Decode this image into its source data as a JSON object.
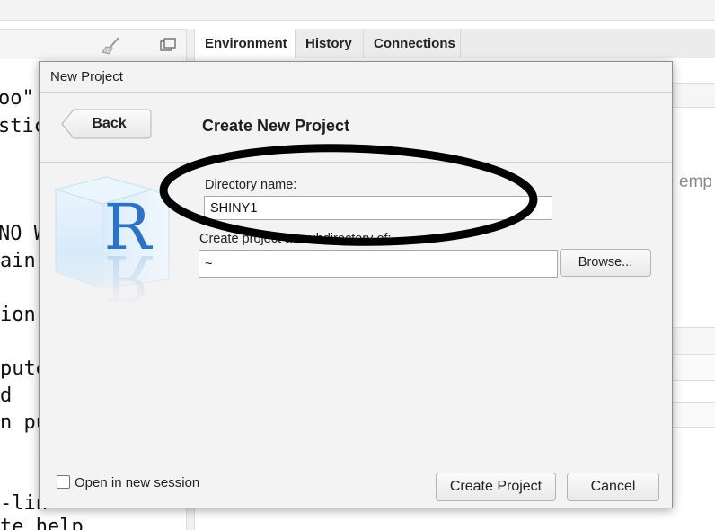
{
  "ide": {
    "tabs": [
      "Environment",
      "History",
      "Connections"
    ],
    "console_lines": [
      "oo\"",
      "stic",
      "NO W",
      "ain",
      "ion",
      "pute",
      "d",
      "n pu",
      "-lin",
      "te help"
    ],
    "environment_empty_text": "emp"
  },
  "dialog": {
    "title": "New Project",
    "back_label": "Back",
    "heading": "Create New Project",
    "directory_name": {
      "label": "Directory name:",
      "value": "SHINY1"
    },
    "subdirectory": {
      "label": "Create project as subdirectory of:",
      "value": "~",
      "browse_label": "Browse..."
    },
    "open_new_session": {
      "label": "Open in new session",
      "checked": false
    },
    "create_label": "Create Project",
    "cancel_label": "Cancel"
  },
  "logo": {
    "letter": "R"
  },
  "annotation": {
    "shape": "ellipse",
    "color": "#000000"
  }
}
